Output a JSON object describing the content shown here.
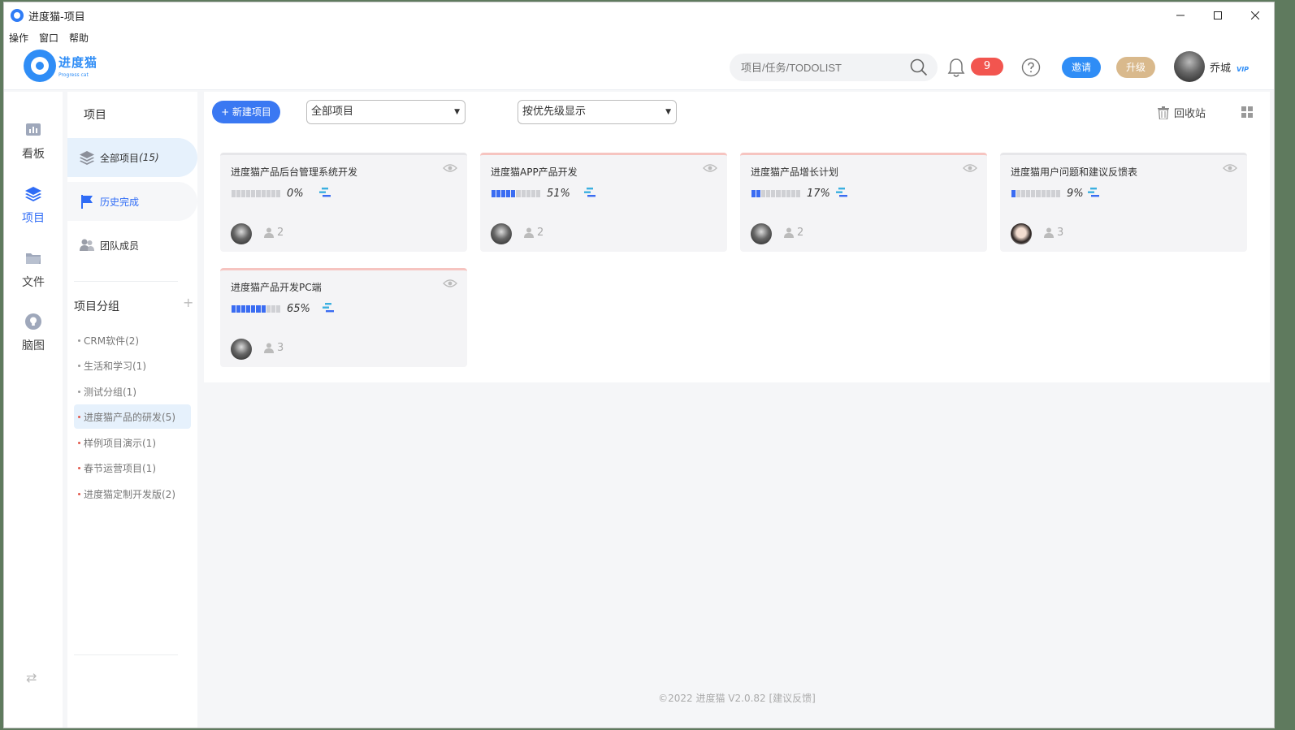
{
  "window": {
    "title": "进度猫-项目"
  },
  "menu": [
    "操作",
    "窗口",
    "帮助"
  ],
  "header": {
    "logo_cn": "进度猫",
    "logo_en": "Progress cat",
    "search_placeholder": "项目/任务/TODOLIST",
    "notifications": "9",
    "invite_label": "邀请",
    "upgrade_label": "升级",
    "user_name": "乔城",
    "vip": "VIP"
  },
  "rail": [
    {
      "label": "看板",
      "icon": "dashboard-icon"
    },
    {
      "label": "项目",
      "icon": "layers-icon",
      "active": true
    },
    {
      "label": "文件",
      "icon": "folder-icon"
    },
    {
      "label": "脑图",
      "icon": "lightbulb-icon"
    }
  ],
  "sidebar": {
    "title": "项目",
    "nav": [
      {
        "label": "全部项目",
        "count": "(15)"
      },
      {
        "label": "历史完成"
      },
      {
        "label": "团队成员"
      }
    ],
    "group_title": "项目分组",
    "groups": [
      "CRM软件(2)",
      "生活和学习(1)",
      "测试分组(1)",
      "进度猫产品的研发(5)",
      "样例项目演示(1)",
      "春节运营项目(1)",
      "进度猫定制开发版(2)"
    ]
  },
  "toolbar": {
    "new_project": "+ 新建项目",
    "filter_value": "全部项目",
    "sort_value": "按优先级显示",
    "trash_label": "回收站"
  },
  "projects": [
    {
      "title": "进度猫产品后台管理系统开发",
      "progress": 0,
      "pct": "0%",
      "members": "2"
    },
    {
      "title": "进度猫APP产品开发",
      "progress": 51,
      "pct": "51%",
      "members": "2"
    },
    {
      "title": "进度猫产品增长计划",
      "progress": 17,
      "pct": "17%",
      "members": "2"
    },
    {
      "title": "进度猫用户问题和建议反馈表",
      "progress": 9,
      "pct": "9%",
      "members": "3"
    },
    {
      "title": "进度猫产品开发PC端",
      "progress": 65,
      "pct": "65%",
      "members": "3"
    }
  ],
  "footer": {
    "copyright": "©2022 进度猫 V2.0.82",
    "feedback": "[建议反馈]"
  },
  "colors": {
    "primary": "#3a78f2",
    "badge": "#f2554f",
    "upgrade": "#d9b98c"
  }
}
